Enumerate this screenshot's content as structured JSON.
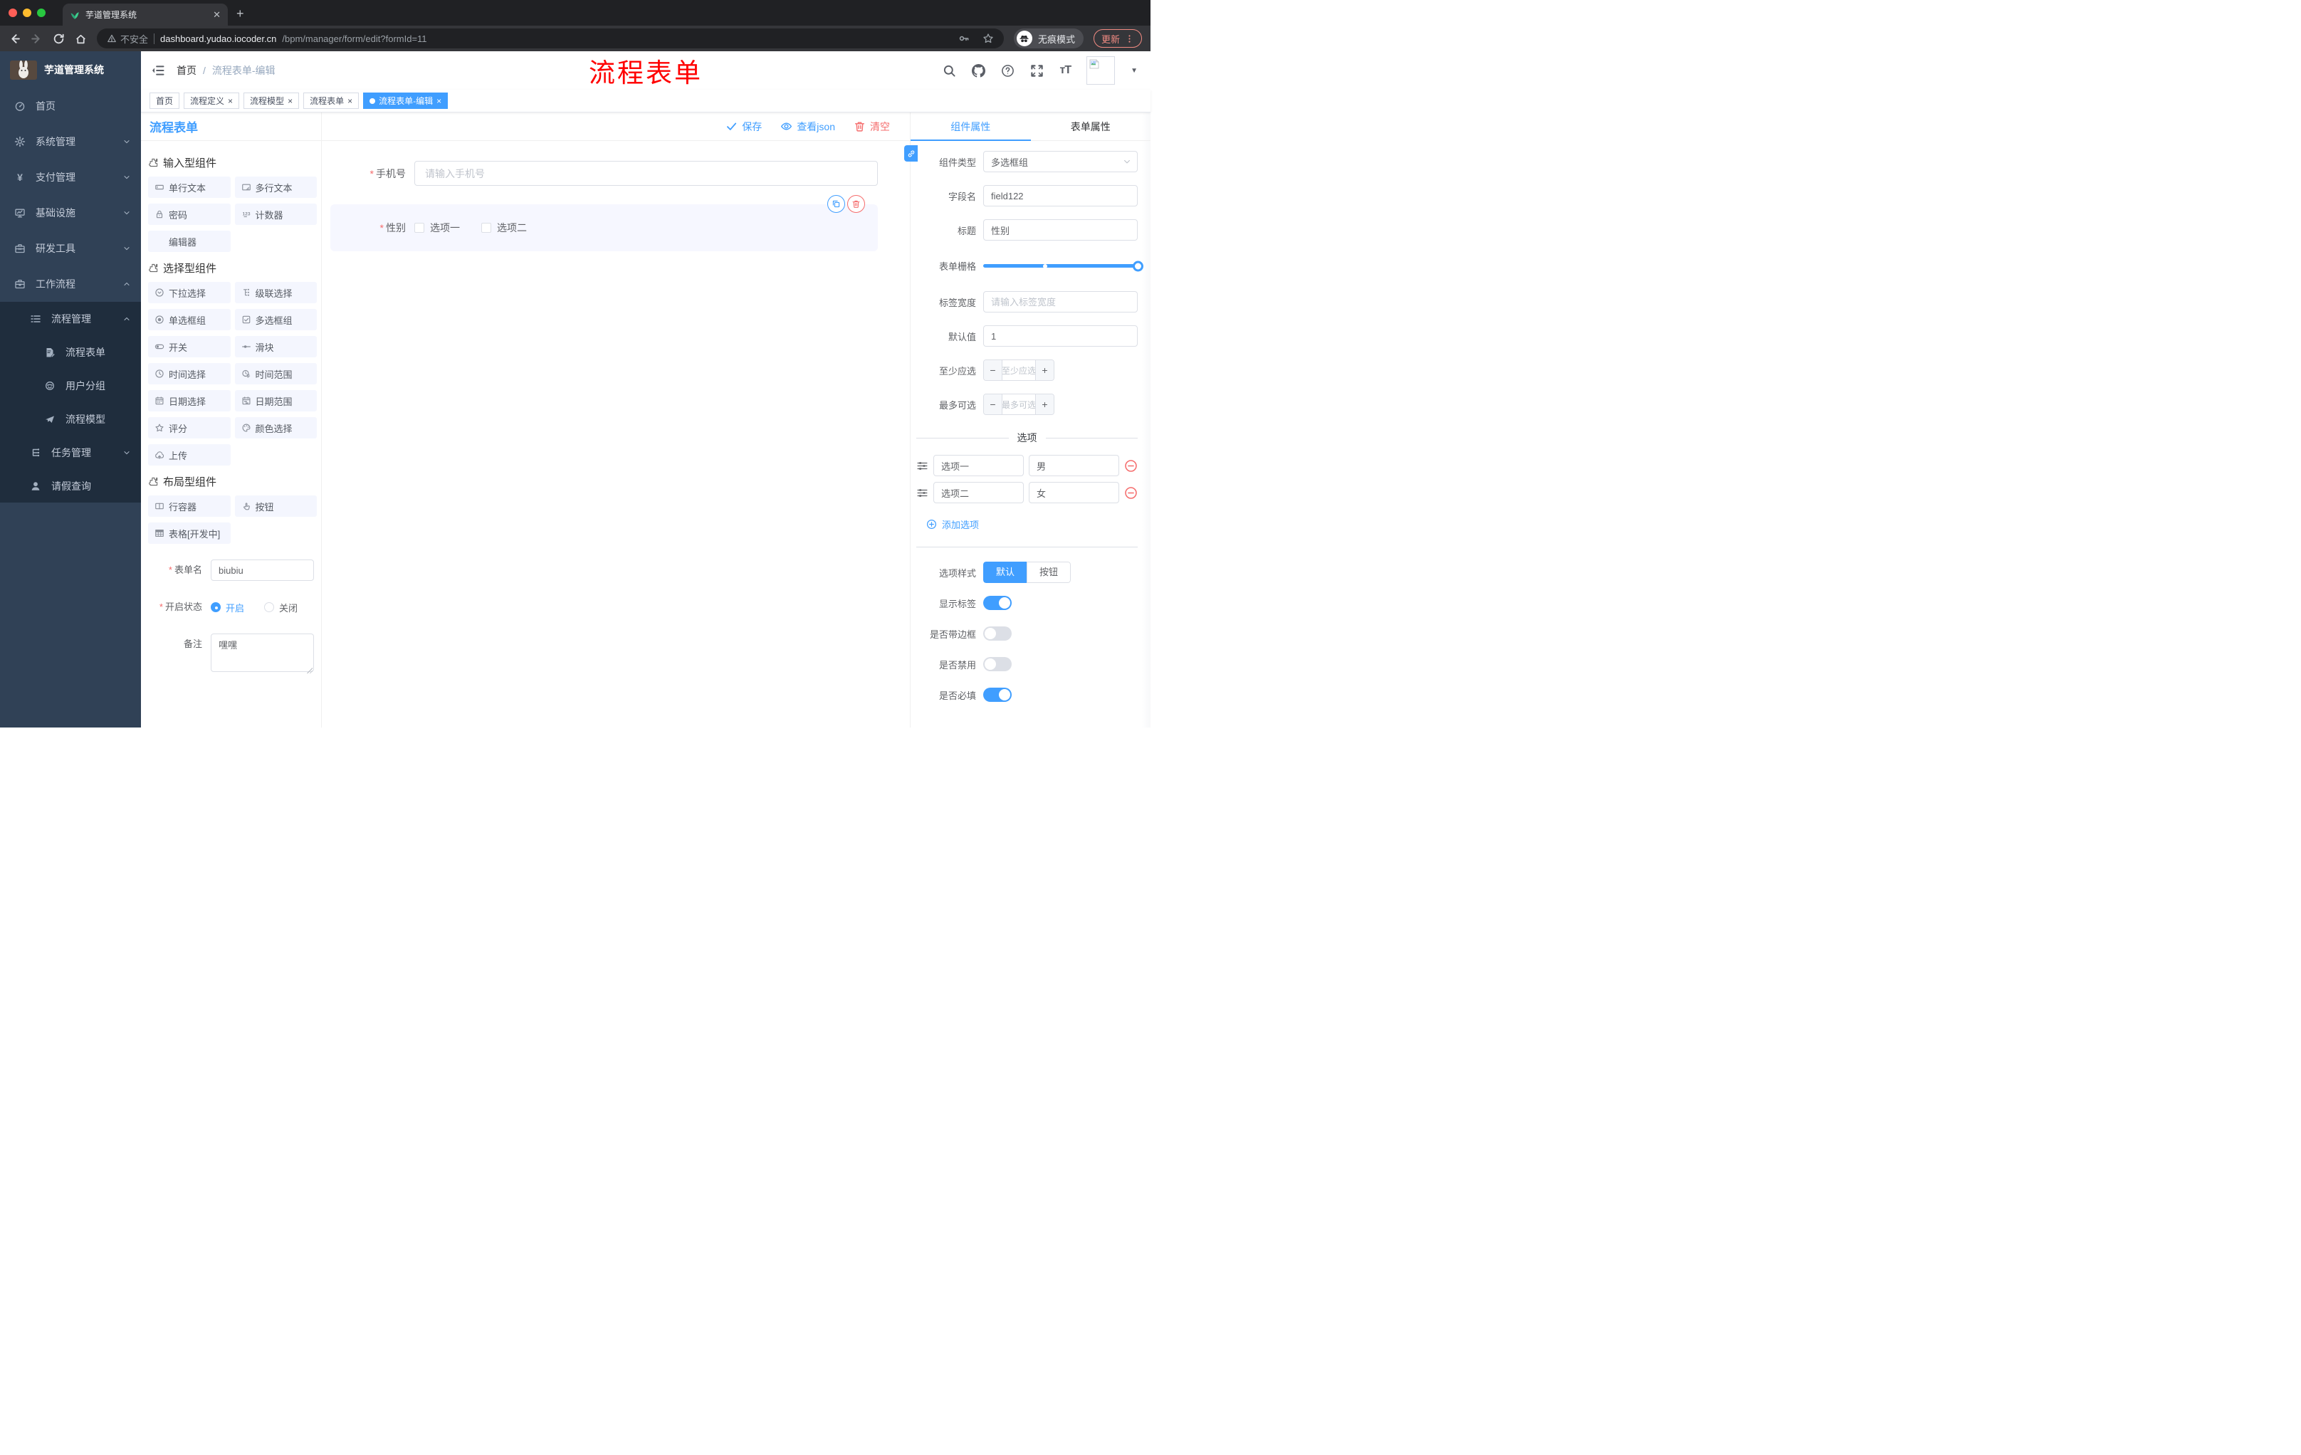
{
  "colors": {
    "accent": "#409eff",
    "danger": "#f56c6c",
    "sidebar_bg": "#304156",
    "submenu_bg": "#1f2d3d",
    "annotation_red": "#ff0000",
    "update_red": "#f28b82"
  },
  "browser": {
    "tab_title": "芋道管理系统",
    "security_label": "不安全",
    "url_host": "dashboard.yudao.iocoder.cn",
    "url_path": "/bpm/manager/form/edit?formId=11",
    "incognito_label": "无痕模式",
    "update_label": "更新"
  },
  "annotation": {
    "text": "流程表单"
  },
  "sidebar": {
    "logo_title": "芋道管理系统",
    "items": [
      {
        "label": "首页",
        "icon": "dashboard",
        "chevron": ""
      },
      {
        "label": "系统管理",
        "icon": "gear",
        "chevron": "down"
      },
      {
        "label": "支付管理",
        "icon": "yen",
        "chevron": "down"
      },
      {
        "label": "基础设施",
        "icon": "monitor",
        "chevron": "down"
      },
      {
        "label": "研发工具",
        "icon": "toolbox",
        "chevron": "down"
      },
      {
        "label": "工作流程",
        "icon": "briefcase",
        "chevron": "up"
      }
    ],
    "submenu": [
      {
        "label": "流程管理",
        "icon": "list-tree",
        "chevron": "up",
        "children": [
          {
            "label": "流程表单",
            "icon": "doc-edit"
          },
          {
            "label": "用户分组",
            "icon": "robot"
          },
          {
            "label": "流程模型",
            "icon": "plane"
          }
        ]
      },
      {
        "label": "任务管理",
        "icon": "org",
        "chevron": "down",
        "children": []
      },
      {
        "label": "请假查询",
        "icon": "user",
        "chevron": "",
        "children": []
      }
    ]
  },
  "header": {
    "breadcrumb_home": "首页",
    "breadcrumb_current": "流程表单-编辑"
  },
  "tags": [
    {
      "label": "首页",
      "closable": false,
      "active": false
    },
    {
      "label": "流程定义",
      "closable": true,
      "active": false
    },
    {
      "label": "流程模型",
      "closable": true,
      "active": false
    },
    {
      "label": "流程表单",
      "closable": true,
      "active": false
    },
    {
      "label": "流程表单-编辑",
      "closable": true,
      "active": true
    }
  ],
  "palette": {
    "title": "流程表单",
    "sections": [
      {
        "title": "输入型组件",
        "items": [
          {
            "label": "单行文本",
            "icon": "single-line"
          },
          {
            "label": "多行文本",
            "icon": "multi-line"
          },
          {
            "label": "密码",
            "icon": "lock"
          },
          {
            "label": "计数器",
            "icon": "counter"
          },
          {
            "label": "编辑器",
            "icon": "none"
          }
        ]
      },
      {
        "title": "选择型组件",
        "items": [
          {
            "label": "下拉选择",
            "icon": "select"
          },
          {
            "label": "级联选择",
            "icon": "cascader"
          },
          {
            "label": "单选框组",
            "icon": "radio"
          },
          {
            "label": "多选框组",
            "icon": "checkbox"
          },
          {
            "label": "开关",
            "icon": "switch"
          },
          {
            "label": "滑块",
            "icon": "slider"
          },
          {
            "label": "时间选择",
            "icon": "time"
          },
          {
            "label": "时间范围",
            "icon": "time-range"
          },
          {
            "label": "日期选择",
            "icon": "date"
          },
          {
            "label": "日期范围",
            "icon": "date-range"
          },
          {
            "label": "评分",
            "icon": "rate"
          },
          {
            "label": "颜色选择",
            "icon": "color"
          },
          {
            "label": "上传",
            "icon": "upload"
          }
        ]
      },
      {
        "title": "布局型组件",
        "items": [
          {
            "label": "行容器",
            "icon": "rowbox"
          },
          {
            "label": "按钮",
            "icon": "button"
          },
          {
            "label": "表格[开发中]",
            "icon": "table"
          }
        ]
      }
    ],
    "form": {
      "name_label": "表单名",
      "name_value": "biubiu",
      "status_label": "开启状态",
      "status_options": [
        {
          "label": "开启",
          "selected": true
        },
        {
          "label": "关闭",
          "selected": false
        }
      ],
      "remark_label": "备注",
      "remark_value": "嘿嘿"
    }
  },
  "canvas": {
    "toolbar": [
      {
        "label": "保存",
        "icon": "check",
        "color": "#409eff"
      },
      {
        "label": "查看json",
        "icon": "eye",
        "color": "#409eff"
      },
      {
        "label": "清空",
        "icon": "trash",
        "color": "#f56c6c"
      }
    ],
    "phone_field": {
      "label": "手机号",
      "required": true,
      "placeholder": "请输入手机号"
    },
    "gender_field": {
      "label": "性别",
      "required": true,
      "options": [
        "选项一",
        "选项二"
      ],
      "selected": true
    }
  },
  "properties": {
    "tabs": [
      {
        "label": "组件属性",
        "active": true
      },
      {
        "label": "表单属性",
        "active": false
      }
    ],
    "component_type": {
      "label": "组件类型",
      "value": "多选框组"
    },
    "field_name": {
      "label": "字段名",
      "value": "field122"
    },
    "title_field": {
      "label": "标题",
      "value": "性别"
    },
    "grid_field": {
      "label": "表单栅格"
    },
    "label_width": {
      "label": "标签宽度",
      "placeholder": "请输入标签宽度"
    },
    "default_value": {
      "label": "默认值",
      "value": "1"
    },
    "min_select": {
      "label": "至少应选",
      "placeholder": "至少应选"
    },
    "max_select": {
      "label": "最多可选",
      "placeholder": "最多可选"
    },
    "options_divider": "选项",
    "options": [
      {
        "name": "选项一",
        "value": "男"
      },
      {
        "name": "选项二",
        "value": "女"
      }
    ],
    "add_option_label": "添加选项",
    "style_row": {
      "label": "选项样式",
      "options": [
        {
          "label": "默认",
          "active": true
        },
        {
          "label": "按钮",
          "active": false
        }
      ]
    },
    "switch_rows": [
      {
        "label": "显示标签",
        "on": true
      },
      {
        "label": "是否带边框",
        "on": false
      },
      {
        "label": "是否禁用",
        "on": false
      },
      {
        "label": "是否必填",
        "on": true
      }
    ]
  }
}
